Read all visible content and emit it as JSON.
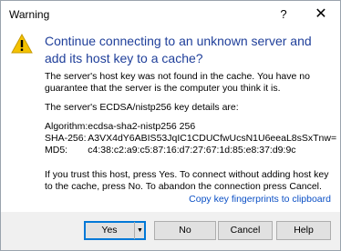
{
  "window": {
    "title": "Warning",
    "help_glyph": "?",
    "close_glyph": "✕"
  },
  "message": {
    "instruction": "Continue connecting to an unknown server and add its host key to a cache?",
    "p1": "The server's host key was not found in the cache. You have no guarantee that the server is the computer you think it is.",
    "p2": "The server's ECDSA/nistp256 key details are:",
    "details": [
      {
        "key": "Algorithm:",
        "value": "ecdsa-sha2-nistp256 256"
      },
      {
        "key": "SHA-256:",
        "value": "A3VX4dY6ABIS53JqIC1CDUCfwUcsN1U6eeaL8sSxTnw="
      },
      {
        "key": "MD5:",
        "value": "c4:38:c2:a9:c5:87:16:d7:27:67:1d:85:e8:37:d9:9c"
      }
    ],
    "p4": "If you trust this host, press Yes. To connect without adding host key to the cache, press No. To abandon the connection press Cancel."
  },
  "links": {
    "copy": "Copy key fingerprints to clipboard"
  },
  "buttons": {
    "yes": "Yes",
    "yes_arrow": "▼",
    "no": "No",
    "cancel": "Cancel",
    "help": "Help"
  },
  "icons": {
    "warning": "warning-triangle-icon"
  },
  "colors": {
    "instruction": "#1f3f9a",
    "link": "#0a4fc5",
    "footer": "#f0f0f0",
    "default_button_border": "#0078d7",
    "warning_yellow": "#f4c200"
  }
}
